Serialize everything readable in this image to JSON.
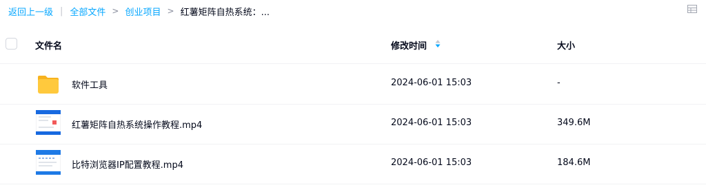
{
  "breadcrumb": {
    "back": "返回上一级",
    "items": [
      "全部文件",
      "创业项目"
    ],
    "current": "红薯矩阵自热系统：..."
  },
  "table": {
    "headers": {
      "name": "文件名",
      "time": "修改时间",
      "size": "大小"
    },
    "rows": [
      {
        "name": "软件工具",
        "time": "2024-06-01 15:03",
        "size": "-",
        "icon": "folder-icon"
      },
      {
        "name": "红薯矩阵自热系统操作教程.mp4",
        "time": "2024-06-01 15:03",
        "size": "349.6M",
        "icon": "video-thumbnail"
      },
      {
        "name": "比特浏览器IP配置教程.mp4",
        "time": "2024-06-01 15:03",
        "size": "184.6M",
        "icon": "video-thumbnail"
      }
    ]
  },
  "colors": {
    "accent": "#06a7ff",
    "folder": "#ffc93d",
    "text": "#03081a"
  }
}
